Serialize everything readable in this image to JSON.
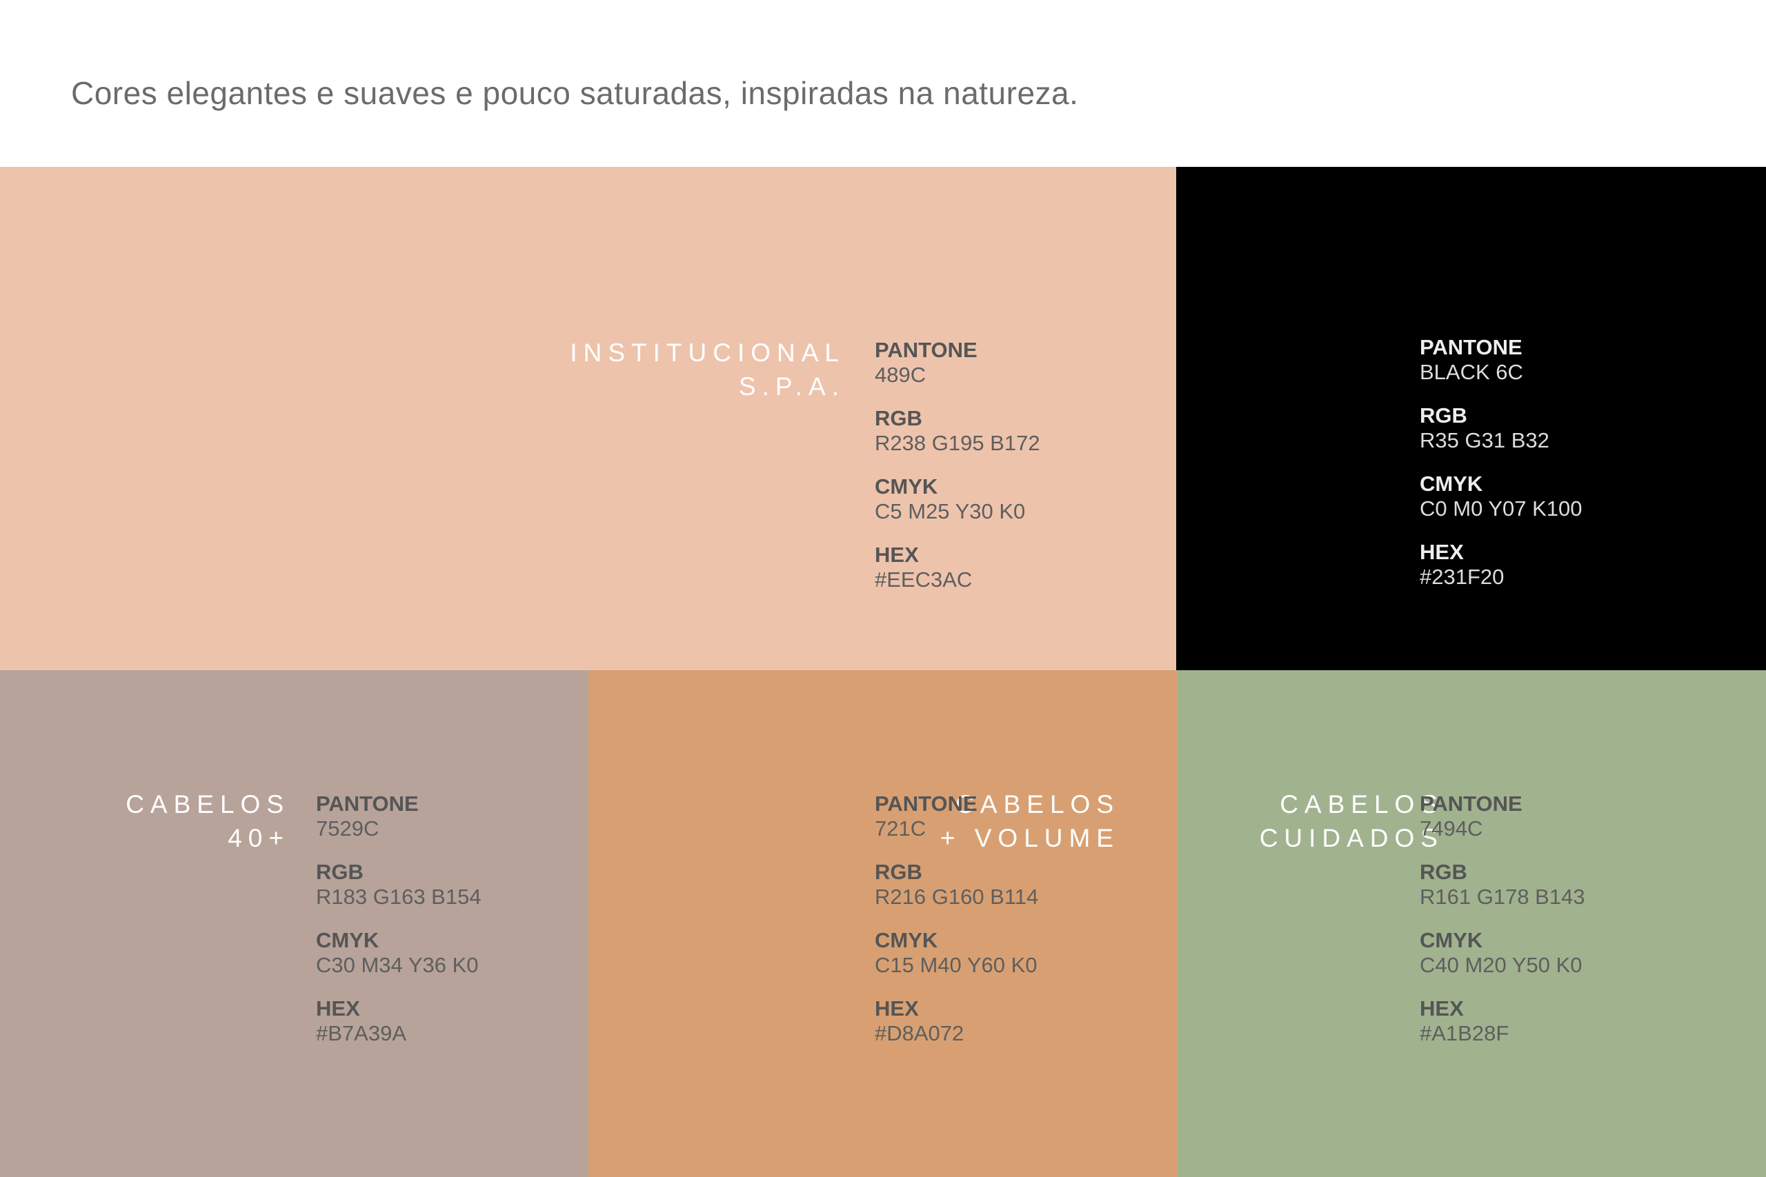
{
  "headline": "Cores elegantes  e suaves e pouco saturadas, inspiradas na natureza.",
  "spec_labels": {
    "pantone": "PANTONE",
    "rgb": "RGB",
    "cmyk": "CMYK",
    "hex": "HEX"
  },
  "swatches": {
    "spa": {
      "color": "#EEC3AC",
      "name_line1": "INSTITUCIONAL",
      "name_line2": "S.P.A.",
      "pantone": "489C",
      "rgb": "R238 G195 B172",
      "cmyk": "C5 M25 Y30 K0",
      "hex": "#EEC3AC"
    },
    "black": {
      "color": "#000000",
      "pantone": "BLACK 6C",
      "rgb": "R35 G31 B32",
      "cmyk": "C0 M0 Y07 K100",
      "hex": "#231F20"
    },
    "cabelos40": {
      "color": "#B7A39A",
      "name_line1": "CABELOS",
      "name_line2": "40+",
      "pantone": "7529C",
      "rgb": "R183 G163 B154",
      "cmyk": "C30 M34 Y36 K0",
      "hex": "#B7A39A"
    },
    "volume": {
      "color": "#D8A072",
      "name_line1": "CABELOS",
      "name_line2": "+ VOLUME",
      "pantone": "721C",
      "rgb": "R216 G160 B114",
      "cmyk": "C15 M40 Y60 K0",
      "hex": "#D8A072"
    },
    "cuidados": {
      "color": "#A1B28F",
      "name_line1": "CABELOS",
      "name_line2": "CUIDADOS",
      "pantone": "7494C",
      "rgb": "R161 G178 B143",
      "cmyk": "C40 M20 Y50 K0",
      "hex": "#A1B28F"
    }
  }
}
